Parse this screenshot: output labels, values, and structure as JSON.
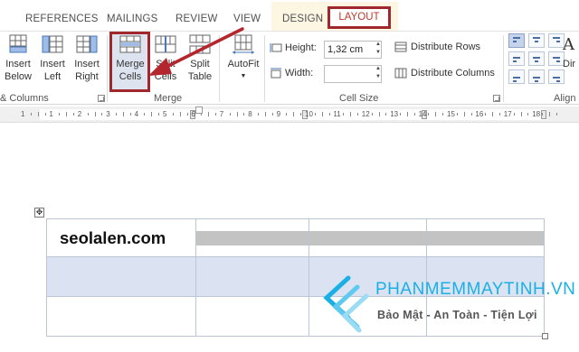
{
  "tabs": {
    "references": "REFERENCES",
    "mailings": "MAILINGS",
    "review": "REVIEW",
    "view": "VIEW",
    "design": "DESIGN",
    "layout": "LAYOUT"
  },
  "ribbon": {
    "insert_below": [
      "Insert",
      "Below"
    ],
    "insert_left": [
      "Insert",
      "Left"
    ],
    "insert_right": [
      "Insert",
      "Right"
    ],
    "merge_cells": [
      "Merge",
      "Cells"
    ],
    "split_cells": [
      "Split",
      "Cells"
    ],
    "split_table": [
      "Split",
      "Table"
    ],
    "autofit": "AutoFit",
    "group_rows_columns": "Columns",
    "group_rows_columns_prefix": "&",
    "group_merge": "Merge",
    "group_cell_size": "Cell Size",
    "group_alignment": "Align",
    "height_label": "Height:",
    "height_value": "1,32 cm",
    "width_label": "Width:",
    "width_value": "",
    "distribute_rows": "Distribute Rows",
    "distribute_columns": "Distribute Columns",
    "direction_partial": "Dir"
  },
  "ruler": {
    "labels": [
      "1",
      "1",
      "2",
      "3",
      "4",
      "5",
      "6",
      "7",
      "8",
      "9",
      "10",
      "11",
      "12",
      "13",
      "14",
      "15",
      "16",
      "17",
      "18"
    ]
  },
  "document": {
    "table_first_cell": "seolalen.com"
  },
  "watermark": {
    "title": "PHANMEMMAYTINH.VN",
    "subtitle": "Bảo Mật - An Toàn - Tiện Lợi"
  },
  "colors": {
    "highlight_border": "#a0282d",
    "layout_tab_text": "#c0392b",
    "selection_fill": "#dbe3f2",
    "header_gray": "#c3c3c3",
    "watermark_blue": "#1ab0e6"
  }
}
